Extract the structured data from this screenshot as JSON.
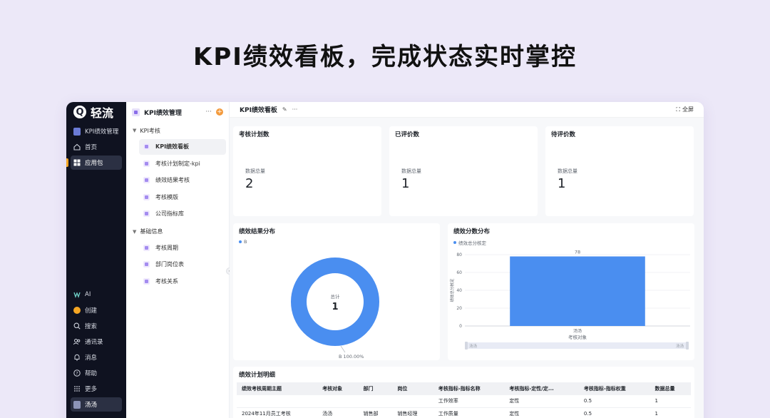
{
  "headline": "KPI绩效看板，完成状态实时掌控",
  "app": {
    "logo_letter": "Q",
    "name": "轻流"
  },
  "leftnav": {
    "top_items": [
      {
        "label": "KPI绩效管理",
        "icon": "app-icon"
      },
      {
        "label": "首页",
        "icon": "home-icon"
      },
      {
        "label": "应用包",
        "icon": "grid-icon"
      }
    ],
    "bottom_items": [
      {
        "label": "AI",
        "icon": "ai-icon"
      },
      {
        "label": "创建",
        "icon": "create-icon"
      },
      {
        "label": "搜索",
        "icon": "search-icon"
      },
      {
        "label": "通讯录",
        "icon": "contacts-icon"
      },
      {
        "label": "消息",
        "icon": "bell-icon"
      },
      {
        "label": "帮助",
        "icon": "help-icon"
      },
      {
        "label": "更多",
        "icon": "more-dots-icon"
      },
      {
        "label": "汤汤",
        "icon": "avatar-icon"
      }
    ]
  },
  "sidebar": {
    "title": "KPI绩效管理",
    "groups": [
      {
        "label": "KPI考核",
        "items": [
          "KPI绩效看板",
          "考核计划制定-kpi",
          "绩效结果考核",
          "考核模版",
          "公司指标库"
        ]
      },
      {
        "label": "基础信息",
        "items": [
          "考核周期",
          "部门岗位表",
          "考核关系"
        ]
      }
    ]
  },
  "main": {
    "title": "KPI绩效看板",
    "fullscreen_label": "全屏"
  },
  "stats": [
    {
      "title": "考核计划数",
      "label": "数据总量",
      "value": "2"
    },
    {
      "title": "已评价数",
      "label": "数据总量",
      "value": "1"
    },
    {
      "title": "待评价数",
      "label": "数据总量",
      "value": "1"
    }
  ],
  "colors": {
    "accent": "#4a8ef0",
    "nav_bg": "#0f1220",
    "page_bg": "#ece8f8"
  },
  "chart_data": [
    {
      "type": "pie",
      "title": "绩效结果分布",
      "legend": [
        "B"
      ],
      "categories": [
        "B"
      ],
      "values": [
        1
      ],
      "center_label": "总计",
      "center_value": "1",
      "slice_label": "B 100.00%"
    },
    {
      "type": "bar",
      "title": "绩效分数分布",
      "legend": [
        "绩效总分核定"
      ],
      "categories": [
        "汤汤"
      ],
      "series": [
        {
          "name": "绩效总分核定",
          "values": [
            78
          ]
        }
      ],
      "xlabel": "考核对象",
      "ylabel": "绩效总分核定",
      "ylim": [
        0,
        80
      ],
      "yticks": [
        "0",
        "20",
        "40",
        "60",
        "80"
      ],
      "data_labels": [
        "78"
      ],
      "slider_left": "汤汤",
      "slider_right": "汤汤"
    }
  ],
  "table": {
    "title": "绩效计划明细",
    "headers": [
      "绩效考核周期主题",
      "考核对象",
      "部门",
      "岗位",
      "考核指标-指标名称",
      "考核指标-定性/定...",
      "考核指标-指标权重",
      "数据总量"
    ],
    "rows": [
      [
        "",
        "",
        "",
        "",
        "工作效率",
        "定性",
        "0.5",
        "1"
      ],
      [
        "2024年11月员工考核",
        "汤汤",
        "销售部",
        "销售经理",
        "工作质量",
        "定性",
        "0.5",
        "1"
      ]
    ]
  }
}
